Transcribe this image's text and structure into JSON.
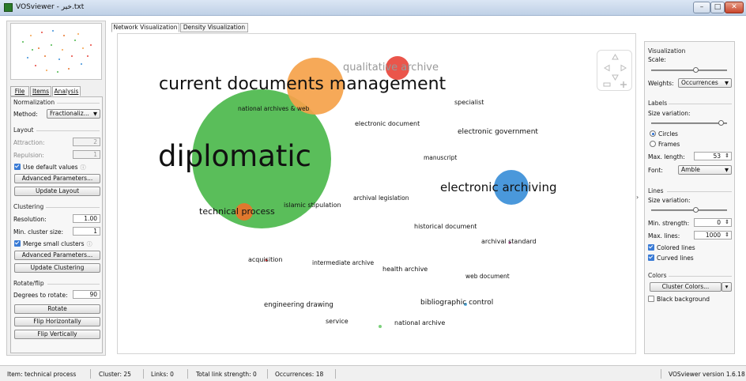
{
  "window": {
    "title": "VOSviewer - خير.txt",
    "minimize_label": "–",
    "maximize_label": "□",
    "close_label": "✕"
  },
  "left_panel": {
    "tabs": [
      "File",
      "Items",
      "Analysis"
    ],
    "active_tab": "Analysis",
    "normalization": {
      "section": "Normalization",
      "method_label": "Method:",
      "method_value": "Fractionaliz..."
    },
    "layout": {
      "section": "Layout",
      "attraction_label": "Attraction:",
      "attraction_value": "2",
      "repulsion_label": "Repulsion:",
      "repulsion_value": "1",
      "use_default_label": "Use default values",
      "use_default_checked": true,
      "advanced_button": "Advanced Parameters...",
      "update_button": "Update Layout"
    },
    "clustering": {
      "section": "Clustering",
      "resolution_label": "Resolution:",
      "resolution_value": "1.00",
      "min_cluster_label": "Min. cluster size:",
      "min_cluster_value": "1",
      "merge_label": "Merge small clusters",
      "merge_checked": true,
      "advanced_button": "Advanced Parameters...",
      "update_button": "Update Clustering"
    },
    "rotate": {
      "section": "Rotate/flip",
      "degrees_label": "Degrees to rotate:",
      "degrees_value": "90",
      "rotate_button": "Rotate",
      "flip_h_button": "Flip Horizontally",
      "flip_v_button": "Flip Vertically"
    }
  },
  "vis_tabs": [
    "Network Visualization",
    "Density Visualization"
  ],
  "active_vis_tab": "Network Visualization",
  "network": {
    "bubbles": [
      {
        "name": "diplomatic",
        "color": "#4cb84c"
      },
      {
        "name": "current documents management",
        "color": "#f5a24a"
      },
      {
        "name": "qualitative archive",
        "color": "#e8463c"
      },
      {
        "name": "electronic archiving",
        "color": "#3b8fd8"
      },
      {
        "name": "technical process",
        "color": "#e8742c"
      }
    ],
    "keywords": [
      "qualitative archive",
      "current documents management",
      "national archives & web",
      "specialist",
      "electronic document",
      "electronic government",
      "diplomatic",
      "manuscript",
      "electronic archiving",
      "archival legislation",
      "islamic stipulation",
      "technical process",
      "historical document",
      "archival standard",
      "acquisition",
      "intermediate archive",
      "health archive",
      "web document",
      "engineering drawing",
      "bibliographic control",
      "service",
      "national archive"
    ]
  },
  "right_panel": {
    "visualization": {
      "section": "Visualization",
      "scale_label": "Scale:",
      "scale_level": 0.6,
      "weights_label": "Weights:",
      "weights_value": "Occurrences"
    },
    "labels": {
      "section": "Labels",
      "size_variation_label": "Size variation:",
      "size_variation_level": 0.95,
      "circles_label": "Circles",
      "frames_label": "Frames",
      "selected_shape": "Circles",
      "max_length_label": "Max. length:",
      "max_length_value": "53",
      "font_label": "Font:",
      "font_value": "Amble"
    },
    "lines": {
      "section": "Lines",
      "size_variation_label": "Size variation:",
      "size_variation_level": 0.6,
      "min_strength_label": "Min. strength:",
      "min_strength_value": "0",
      "max_lines_label": "Max. lines:",
      "max_lines_value": "1000",
      "colored_label": "Colored lines",
      "colored_checked": true,
      "curved_label": "Curved lines",
      "curved_checked": true
    },
    "colors": {
      "section": "Colors",
      "cluster_colors_button": "Cluster Colors...",
      "black_bg_label": "Black background",
      "black_bg_checked": false
    }
  },
  "status": {
    "item": "Item:  technical process",
    "cluster": "Cluster:  25",
    "links": "Links:  0",
    "total_link_strength": "Total link strength:  0",
    "occurrences": "Occurrences:  18",
    "version": "VOSviewer version 1.6.18"
  }
}
